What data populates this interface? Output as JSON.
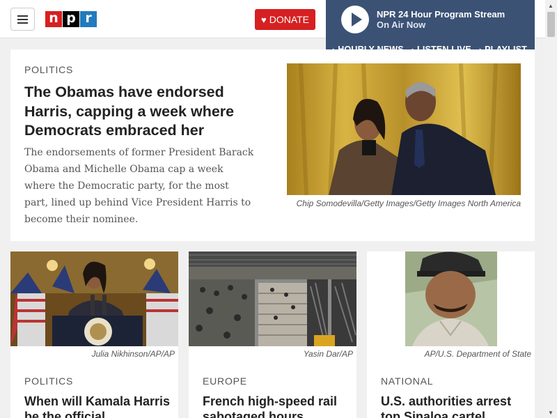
{
  "header": {
    "logo_letters": [
      "n",
      "p",
      "r"
    ],
    "donate_label": "DONATE",
    "icons": {
      "menu": "hamburger-icon",
      "donate": "heart-icon"
    }
  },
  "player": {
    "title": "NPR 24 Hour Program Stream",
    "subtitle": "On Air Now",
    "links": [
      {
        "label": "HOURLY NEWS"
      },
      {
        "label": "LISTEN LIVE"
      },
      {
        "label": "PLAYLIST"
      }
    ],
    "icons": {
      "play": "play-icon"
    }
  },
  "lead": {
    "slug": "POLITICS",
    "headline": "The Obamas have endorsed Harris, capping a week where Democrats embraced her",
    "teaser": "The endorsements of former President Barack Obama and Michelle Obama cap a week where the Democratic party, for the most part, lined up behind Vice President Harris to become their nominee.",
    "credit": "Chip Somodevilla/Getty Images/Getty Images North America"
  },
  "cards": [
    {
      "slug": "POLITICS",
      "headline": "When will Kamala Harris be the official",
      "credit": "Julia Nikhinson/AP/AP"
    },
    {
      "slug": "EUROPE",
      "headline": "French high-speed rail sabotaged hours",
      "credit": "Yasin Dar/AP"
    },
    {
      "slug": "NATIONAL",
      "headline": "U.S. authorities arrest top Sinaloa cartel",
      "credit": "AP/U.S. Department of State"
    }
  ],
  "colors": {
    "brand_red": "#d62021",
    "player_bg": "#3b5275",
    "logo_blue": "#237bbd"
  }
}
